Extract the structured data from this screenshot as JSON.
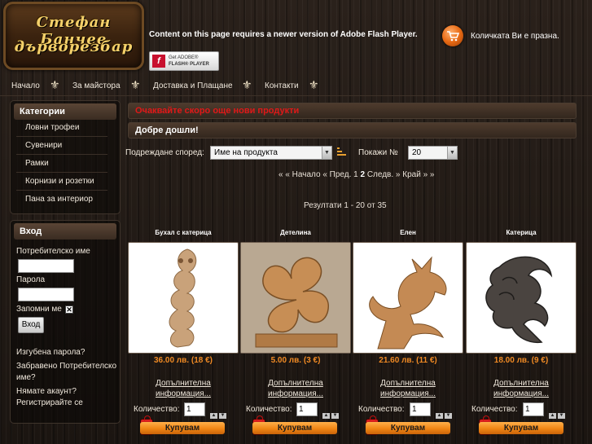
{
  "header": {
    "logo_line1": "Стефан Банчев",
    "logo_line2": "дърворезбар",
    "flash_message": "Content on this page requires a newer version of Adobe Flash Player.",
    "flash_button_line1": "Get ADOBE®",
    "flash_button_line2": "FLASH® PLAYER",
    "cart_text": "Количката Ви е празна."
  },
  "nav": {
    "items": [
      "Начало",
      "За майстора",
      "Доставка и Плащане",
      "Контакти"
    ],
    "separator": "⚜"
  },
  "categories": {
    "title": "Категории",
    "items": [
      "Ловни трофеи",
      "Сувенири",
      "Рамки",
      "Корнизи и розетки",
      "Пана за интериор"
    ]
  },
  "login": {
    "title": "Вход",
    "username_label": "Потребителско име",
    "password_label": "Парола",
    "remember_label": "Запомни ме",
    "remember_mark": "✕",
    "submit_label": "Вход",
    "forgot_password": "Изгубена парола?",
    "forgot_username": "Забравено Потребителско име?",
    "no_account": "Нямате акаунт?",
    "register": "Регистрирайте се"
  },
  "main": {
    "notice": "Очаквайте скоро още нови продукти",
    "welcome": "Добре дошли!",
    "sort_label": "Подреждане според:",
    "sort_value": "Име на продукта",
    "sort_direction_icon": "sort-icon",
    "show_label": "Покажи №",
    "show_value": "20",
    "pager": {
      "first": "« « Начало",
      "prev": "« Пред.",
      "pages": [
        "1",
        "2"
      ],
      "next": "Следв. »",
      "last": "Край » »"
    },
    "results": "Резултати 1 - 20 от 35"
  },
  "products": [
    {
      "name": "Бухал с катерица",
      "price": "36.00 лв. (18 €)",
      "more": "Допълнителна информация...",
      "qty_label": "Количество:",
      "qty": "1",
      "buy": "Купувам"
    },
    {
      "name": "Детелина",
      "price": "5.00 лв. (3 €)",
      "more": "Допълнителна информация...",
      "qty_label": "Количество:",
      "qty": "1",
      "buy": "Купувам"
    },
    {
      "name": "Елен",
      "price": "21.60 лв. (11 €)",
      "more": "Допълнителна информация...",
      "qty_label": "Количество:",
      "qty": "1",
      "buy": "Купувам"
    },
    {
      "name": "Катерица",
      "price": "18.00 лв. (9 €)",
      "more": "Допълнителна информация...",
      "qty_label": "Количество:",
      "qty": "1",
      "buy": "Купувам"
    }
  ],
  "colors": {
    "accent_orange": "#f08514",
    "notice_red": "#e01818",
    "price_orange": "#f08a24",
    "wood_dark": "#1a1410"
  }
}
